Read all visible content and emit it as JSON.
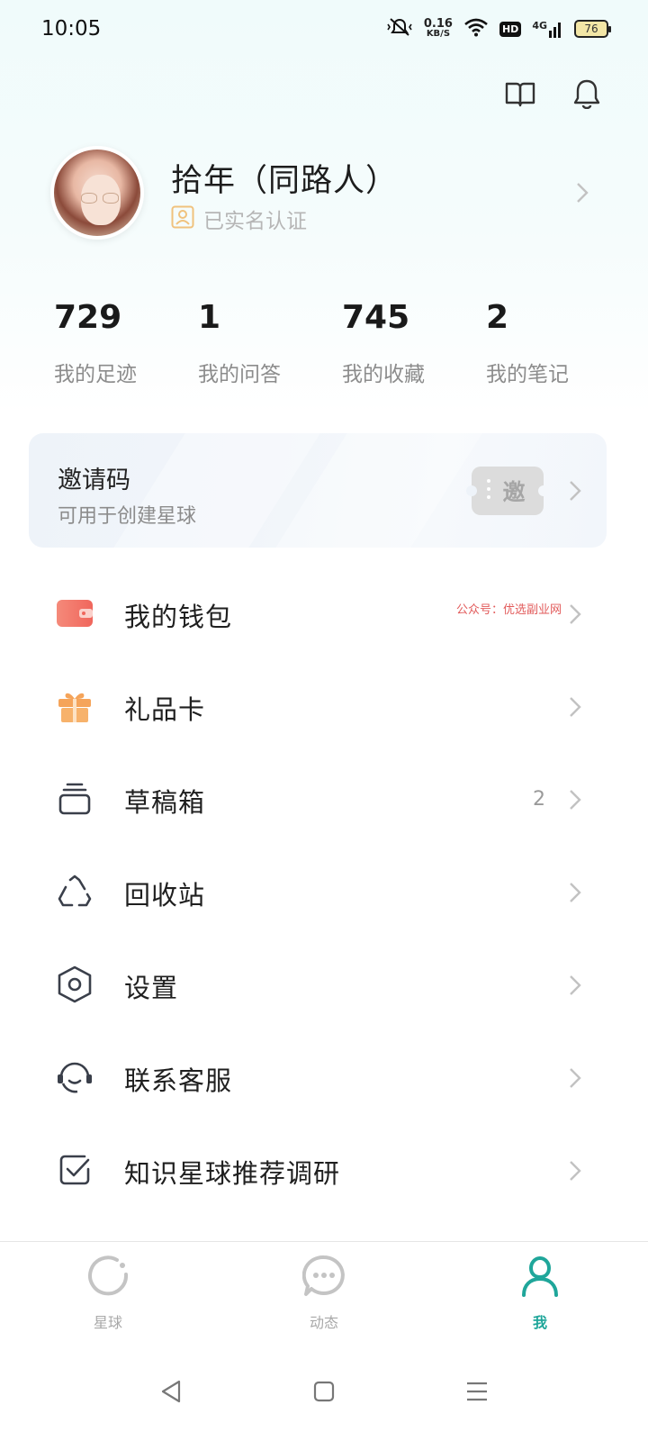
{
  "status": {
    "time": "10:05",
    "speed_value": "0.16",
    "speed_unit": "KB/S",
    "hd": "HD",
    "network": "4G",
    "battery": "76"
  },
  "header": {
    "icons": [
      "book-icon",
      "bell-icon"
    ]
  },
  "profile": {
    "name": "拾年（同路人）",
    "verification": "已实名认证"
  },
  "stats": [
    {
      "value": "729",
      "label": "我的足迹"
    },
    {
      "value": "1",
      "label": "我的问答"
    },
    {
      "value": "745",
      "label": "我的收藏"
    },
    {
      "value": "2",
      "label": "我的笔记"
    }
  ],
  "invite": {
    "title": "邀请码",
    "subtitle": "可用于创建星球",
    "ticket": "邀"
  },
  "menu": [
    {
      "label": "我的钱包",
      "icon": "wallet-icon",
      "note": "公众号：优选副业网"
    },
    {
      "label": "礼品卡",
      "icon": "gift-icon"
    },
    {
      "label": "草稿箱",
      "icon": "drafts-icon",
      "count": "2"
    },
    {
      "label": "回收站",
      "icon": "recycle-icon"
    },
    {
      "label": "设置",
      "icon": "settings-icon"
    },
    {
      "label": "联系客服",
      "icon": "headset-icon"
    },
    {
      "label": "知识星球推荐调研",
      "icon": "survey-icon"
    }
  ],
  "tabs": [
    {
      "label": "星球",
      "icon": "planet-icon"
    },
    {
      "label": "动态",
      "icon": "chat-icon"
    },
    {
      "label": "我",
      "icon": "person-icon",
      "active": true
    }
  ],
  "colors": {
    "accent": "#1fa69a",
    "wallet": "#f2766a",
    "gift": "#f5a45a",
    "verify": "#f0c27d"
  }
}
